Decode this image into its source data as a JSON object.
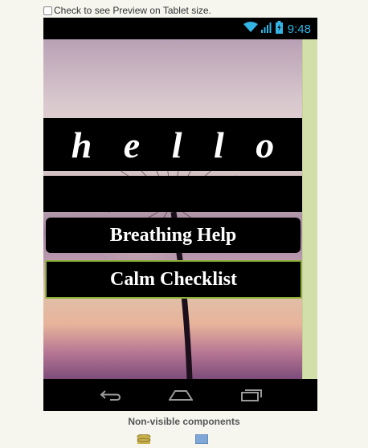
{
  "preview_toggle": {
    "label": "Check to see Preview on Tablet size.",
    "checked": false
  },
  "status_bar": {
    "time": "9:48",
    "icons": [
      "wifi-icon",
      "signal-icon",
      "battery-icon"
    ],
    "icon_color": "#33b5e5"
  },
  "screen": {
    "title_label": "h e l l o",
    "buttons": [
      {
        "label": "Breathing Help"
      },
      {
        "label": "Calm Checklist"
      }
    ]
  },
  "nav_bar": {
    "icons": [
      "back-icon",
      "home-icon",
      "recent-apps-icon"
    ]
  },
  "non_visible": {
    "heading": "Non-visible components",
    "icons": [
      "database-icon",
      "component-icon"
    ]
  },
  "colors": {
    "scrollbar": "#d3dfa8",
    "selected_border": "#8db03a",
    "clock": "#33b5e5"
  }
}
